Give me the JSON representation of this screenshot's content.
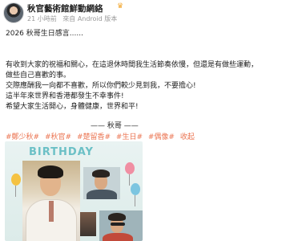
{
  "post": {
    "author": "秋官藝術館鮮動網絡",
    "meta": {
      "time": "21 小時前",
      "source": "來自 Android 版本"
    },
    "lines": {
      "title": "2026 秋哥生日感言......",
      "p1_line1": "有收到大家的祝福和關心，在這退休時間我生活節奏依慢，但還是有做些運動，",
      "p1_line2": "做些自己喜歡的事。",
      "p2": "交際應酬我一向都不喜歡，所以你們較少見到我，不要擔心!",
      "p3": "這半年來世界和香港都發生不幸事件!",
      "p4": "希望大家生活開心，身體健康，世界和平!"
    },
    "signature": "——  秋哥  ——",
    "tags": [
      "#鄭少秋#",
      "#秋官#",
      "#楚留香#",
      "#生日#",
      "#偶像#",
      "收起"
    ],
    "image": {
      "banner_text": "BIRTHDAY"
    }
  },
  "colors": {
    "tag": "#eb7350",
    "meta": "#999999",
    "banner": "#6bc0c6"
  },
  "icons": {
    "vip": "crown-icon"
  }
}
